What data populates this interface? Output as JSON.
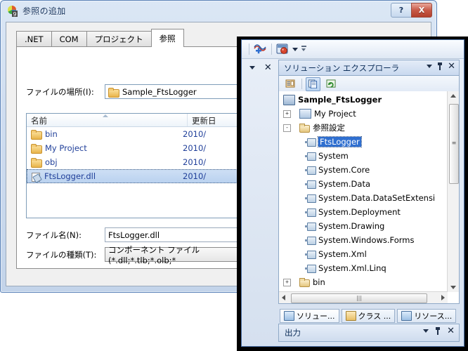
{
  "dialog": {
    "title": "参照の追加",
    "icon": "add-reference-icon",
    "help_label": "?",
    "close_label": "X",
    "tabs": [
      {
        "label": ".NET",
        "active": false
      },
      {
        "label": "COM",
        "active": false
      },
      {
        "label": "プロジェクト",
        "active": false
      },
      {
        "label": "参照",
        "active": true
      }
    ],
    "location": {
      "label": "ファイルの場所(I):",
      "value": "Sample_FtsLogger",
      "icon": "folder-icon"
    },
    "list": {
      "columns": [
        "名前",
        "更新日"
      ],
      "rows": [
        {
          "name": "bin",
          "date": "2010/",
          "icon": "folder-icon",
          "selected": false
        },
        {
          "name": "My Project",
          "date": "2010/",
          "icon": "folder-icon",
          "selected": false
        },
        {
          "name": "obj",
          "date": "2010/",
          "icon": "folder-icon",
          "selected": false
        },
        {
          "name": "FtsLogger.dll",
          "date": "2010/",
          "icon": "dll-icon",
          "selected": true
        }
      ]
    },
    "filename": {
      "label": "ファイル名(N):",
      "value": "FtsLogger.dll"
    },
    "filetype": {
      "label": "ファイルの種類(T):",
      "value": "コンポーネント ファイル (*.dll;*.tlb;*.olb;*"
    }
  },
  "vs": {
    "autohide": {
      "caret": "▼",
      "close": "✕"
    },
    "panel": {
      "title": "ソリューション エクスプローラ",
      "toolbar": [
        {
          "name": "properties-icon",
          "active": false
        },
        {
          "name": "show-all-files-icon",
          "active": true
        },
        {
          "name": "refresh-icon",
          "active": false
        }
      ],
      "tree": [
        {
          "label": "Sample_FtsLogger",
          "level": 0,
          "icon": "project-icon",
          "expander": "",
          "bold": true,
          "selected": false
        },
        {
          "label": "My Project",
          "level": 1,
          "icon": "myproject-icon",
          "expander": "+",
          "bold": false,
          "selected": false
        },
        {
          "label": "参照設定",
          "level": 1,
          "icon": "folder-icon",
          "expander": "-",
          "bold": false,
          "selected": false
        },
        {
          "label": "FtsLogger",
          "level": 2,
          "icon": "reference-icon",
          "expander": "",
          "bold": false,
          "selected": true
        },
        {
          "label": "System",
          "level": 2,
          "icon": "reference-icon",
          "expander": "",
          "bold": false,
          "selected": false
        },
        {
          "label": "System.Core",
          "level": 2,
          "icon": "reference-icon",
          "expander": "",
          "bold": false,
          "selected": false
        },
        {
          "label": "System.Data",
          "level": 2,
          "icon": "reference-icon",
          "expander": "",
          "bold": false,
          "selected": false
        },
        {
          "label": "System.Data.DataSetExtensi",
          "level": 2,
          "icon": "reference-icon",
          "expander": "",
          "bold": false,
          "selected": false
        },
        {
          "label": "System.Deployment",
          "level": 2,
          "icon": "reference-icon",
          "expander": "",
          "bold": false,
          "selected": false
        },
        {
          "label": "System.Drawing",
          "level": 2,
          "icon": "reference-icon",
          "expander": "",
          "bold": false,
          "selected": false
        },
        {
          "label": "System.Windows.Forms",
          "level": 2,
          "icon": "reference-icon",
          "expander": "",
          "bold": false,
          "selected": false
        },
        {
          "label": "System.Xml",
          "level": 2,
          "icon": "reference-icon",
          "expander": "",
          "bold": false,
          "selected": false
        },
        {
          "label": "System.Xml.Linq",
          "level": 2,
          "icon": "reference-icon",
          "expander": "",
          "bold": false,
          "selected": false
        },
        {
          "label": "bin",
          "level": 1,
          "icon": "folder-icon",
          "expander": "+",
          "bold": false,
          "selected": false
        }
      ]
    },
    "doc_tabs": [
      {
        "label": "ソリュー...",
        "icon": "solution-explorer-icon",
        "active": true
      },
      {
        "label": "クラス ...",
        "icon": "class-view-icon",
        "active": false
      },
      {
        "label": "リソース...",
        "icon": "resource-view-icon",
        "active": false
      }
    ],
    "output": {
      "title": "出力",
      "caret": "▼",
      "pin": "pin-icon",
      "close": "✕"
    }
  },
  "colors": {
    "selection": "#2f6fd0",
    "dialog_accent": "#5a82b8",
    "close_button": "#c75a48"
  }
}
